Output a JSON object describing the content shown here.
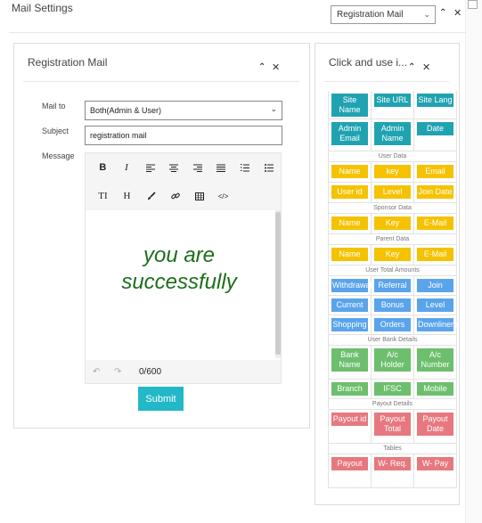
{
  "header": {
    "title": "Mail Settings",
    "template_select": "Registration Mail"
  },
  "form_card": {
    "title": "Registration Mail",
    "mail_to_label": "Mail to",
    "mail_to_value": "Both(Admin & User)",
    "subject_label": "Subject",
    "subject_value": "registration mail",
    "message_label": "Message",
    "toolbar_row1": [
      "B",
      "I",
      "align-left-icon",
      "align-center-icon",
      "align-right-icon",
      "align-justify-icon",
      "ordered-list-icon",
      "bullet-list-icon"
    ],
    "toolbar_row2": [
      "text-size-icon",
      "heading-icon",
      "brush-icon",
      "link-icon",
      "table-icon",
      "code-icon"
    ],
    "toolbar_text": {
      "bold": "B",
      "italic": "I",
      "textsize": "TI",
      "heading": "H"
    },
    "editor_text_line1": "you are",
    "editor_text_line2": "successfully",
    "char_count": "0/600",
    "submit_label": "Submit"
  },
  "variables_card": {
    "title": "Click and use i...",
    "rows": [
      [
        "Site Name",
        "Site URL",
        "Site Lang"
      ],
      [
        "Admin Email",
        "Admin Name",
        "Date"
      ]
    ],
    "sections": [
      {
        "label": "User Data",
        "rows": [
          [
            "Name",
            "key",
            "Email"
          ],
          [
            "User id",
            "Level",
            "Join Date"
          ]
        ]
      },
      {
        "label": "Sponsor Data",
        "rows": [
          [
            "Name",
            "Key",
            "E-Mail"
          ]
        ]
      },
      {
        "label": "Parent Data",
        "rows": [
          [
            "Name",
            "Key",
            "E-Mail"
          ]
        ]
      },
      {
        "label": "User Total Amounts",
        "rows": [
          [
            "Withdrawal",
            "Referral",
            "Join"
          ],
          [
            "Current",
            "Bonus",
            "Level"
          ],
          [
            "Shopping",
            "Orders",
            "Downliners"
          ]
        ]
      },
      {
        "label": "User Bank Details",
        "rows": [
          [
            "Bank Name",
            "A/c Holder",
            "A/c Number"
          ],
          [
            "Branch",
            "IFSC",
            "Mobile"
          ]
        ]
      },
      {
        "label": "Payout Details",
        "rows": [
          [
            "Payout id",
            "Payout Total",
            "Payout Date"
          ]
        ]
      },
      {
        "label": "Tables",
        "rows": [
          [
            "Payout",
            "W- Req.",
            "W- Pay"
          ]
        ]
      }
    ]
  },
  "colors": {
    "teal": "#20a3b1",
    "yellow": "#f5c200",
    "blue": "#5aa4ec",
    "green": "#6dbf6d",
    "red": "#e7787f",
    "editor_text": "#1c6e1a",
    "submit": "#22b8c8"
  }
}
